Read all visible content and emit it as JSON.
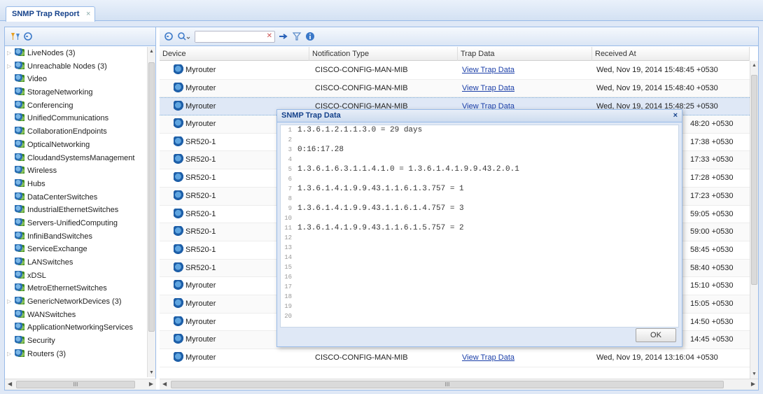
{
  "tab": {
    "title": "SNMP Trap Report",
    "close": "×"
  },
  "tree": {
    "items": [
      {
        "label": "LiveNodes (3)",
        "expandable": true
      },
      {
        "label": "Unreachable Nodes (3)",
        "expandable": true
      },
      {
        "label": "Video",
        "expandable": false
      },
      {
        "label": "StorageNetworking",
        "expandable": false
      },
      {
        "label": "Conferencing",
        "expandable": false
      },
      {
        "label": "UnifiedCommunications",
        "expandable": false
      },
      {
        "label": "CollaborationEndpoints",
        "expandable": false
      },
      {
        "label": "OpticalNetworking",
        "expandable": false
      },
      {
        "label": "CloudandSystemsManagement",
        "expandable": false
      },
      {
        "label": "Wireless",
        "expandable": false
      },
      {
        "label": "Hubs",
        "expandable": false
      },
      {
        "label": "DataCenterSwitches",
        "expandable": false
      },
      {
        "label": "IndustrialEthernetSwitches",
        "expandable": false
      },
      {
        "label": "Servers-UnifiedComputing",
        "expandable": false
      },
      {
        "label": "InfiniBandSwitches",
        "expandable": false
      },
      {
        "label": "ServiceExchange",
        "expandable": false
      },
      {
        "label": "LANSwitches",
        "expandable": false
      },
      {
        "label": "xDSL",
        "expandable": false
      },
      {
        "label": "MetroEthernetSwitches",
        "expandable": false
      },
      {
        "label": "GenericNetworkDevices (3)",
        "expandable": true
      },
      {
        "label": "WANSwitches",
        "expandable": false
      },
      {
        "label": "ApplicationNetworkingServices",
        "expandable": false
      },
      {
        "label": "Security",
        "expandable": false
      },
      {
        "label": "Routers (3)",
        "expandable": true
      }
    ]
  },
  "grid": {
    "search_value": "",
    "columns": [
      "Device",
      "Notification Type",
      "Trap Data",
      "Received At"
    ],
    "rows": [
      {
        "device": "Myrouter",
        "type": "CISCO-CONFIG-MAN-MIB",
        "trap": "View Trap Data",
        "received": "Wed, Nov 19, 2014 15:48:45 +0530"
      },
      {
        "device": "Myrouter",
        "type": "CISCO-CONFIG-MAN-MIB",
        "trap": "View Trap Data",
        "received": "Wed, Nov 19, 2014 15:48:40 +0530"
      },
      {
        "device": "Myrouter",
        "type": "CISCO-CONFIG-MAN-MIB",
        "trap": "View Trap Data",
        "received": "Wed, Nov 19, 2014 15:48:25 +0530"
      },
      {
        "device": "Myrouter",
        "type": "",
        "trap": "",
        "received": "48:20 +0530"
      },
      {
        "device": "SR520-1",
        "type": "",
        "trap": "",
        "received": "17:38 +0530"
      },
      {
        "device": "SR520-1",
        "type": "",
        "trap": "",
        "received": "17:33 +0530"
      },
      {
        "device": "SR520-1",
        "type": "",
        "trap": "",
        "received": "17:28 +0530"
      },
      {
        "device": "SR520-1",
        "type": "",
        "trap": "",
        "received": "17:23 +0530"
      },
      {
        "device": "SR520-1",
        "type": "",
        "trap": "",
        "received": "59:05 +0530"
      },
      {
        "device": "SR520-1",
        "type": "",
        "trap": "",
        "received": "59:00 +0530"
      },
      {
        "device": "SR520-1",
        "type": "",
        "trap": "",
        "received": "58:45 +0530"
      },
      {
        "device": "SR520-1",
        "type": "",
        "trap": "",
        "received": "58:40 +0530"
      },
      {
        "device": "Myrouter",
        "type": "",
        "trap": "",
        "received": "15:10 +0530"
      },
      {
        "device": "Myrouter",
        "type": "",
        "trap": "",
        "received": "15:05 +0530"
      },
      {
        "device": "Myrouter",
        "type": "",
        "trap": "",
        "received": "14:50 +0530"
      },
      {
        "device": "Myrouter",
        "type": "",
        "trap": "",
        "received": "14:45 +0530"
      },
      {
        "device": "Myrouter",
        "type": "CISCO-CONFIG-MAN-MIB",
        "trap": "View Trap Data",
        "received": "Wed, Nov 19, 2014 13:16:04 +0530"
      }
    ],
    "selected_row": 2
  },
  "dialog": {
    "title": "SNMP Trap Data",
    "close": "×",
    "ok_label": "OK",
    "lines": [
      {
        "n": "1",
        "t": "1.3.6.1.2.1.1.3.0 = 29 days"
      },
      {
        "n": "2",
        "t": ""
      },
      {
        "n": "3",
        "t": "0:16:17.28"
      },
      {
        "n": "4",
        "t": ""
      },
      {
        "n": "5",
        "t": "1.3.6.1.6.3.1.1.4.1.0 = 1.3.6.1.4.1.9.9.43.2.0.1"
      },
      {
        "n": "6",
        "t": ""
      },
      {
        "n": "7",
        "t": "1.3.6.1.4.1.9.9.43.1.1.6.1.3.757 = 1"
      },
      {
        "n": "8",
        "t": ""
      },
      {
        "n": "9",
        "t": "1.3.6.1.4.1.9.9.43.1.1.6.1.4.757 = 3"
      },
      {
        "n": "10",
        "t": ""
      },
      {
        "n": "11",
        "t": "1.3.6.1.4.1.9.9.43.1.1.6.1.5.757 = 2"
      },
      {
        "n": "12",
        "t": ""
      },
      {
        "n": "13",
        "t": ""
      },
      {
        "n": "14",
        "t": ""
      },
      {
        "n": "15",
        "t": ""
      },
      {
        "n": "16",
        "t": ""
      },
      {
        "n": "17",
        "t": ""
      },
      {
        "n": "18",
        "t": ""
      },
      {
        "n": "19",
        "t": ""
      },
      {
        "n": "20",
        "t": ""
      }
    ]
  },
  "scrollbar": {
    "thumb_glyph": "III"
  },
  "colors": {
    "accent": "#15428b",
    "border": "#99bbe8",
    "link": "#1a3ea8",
    "selected": "#dfe8f6"
  }
}
